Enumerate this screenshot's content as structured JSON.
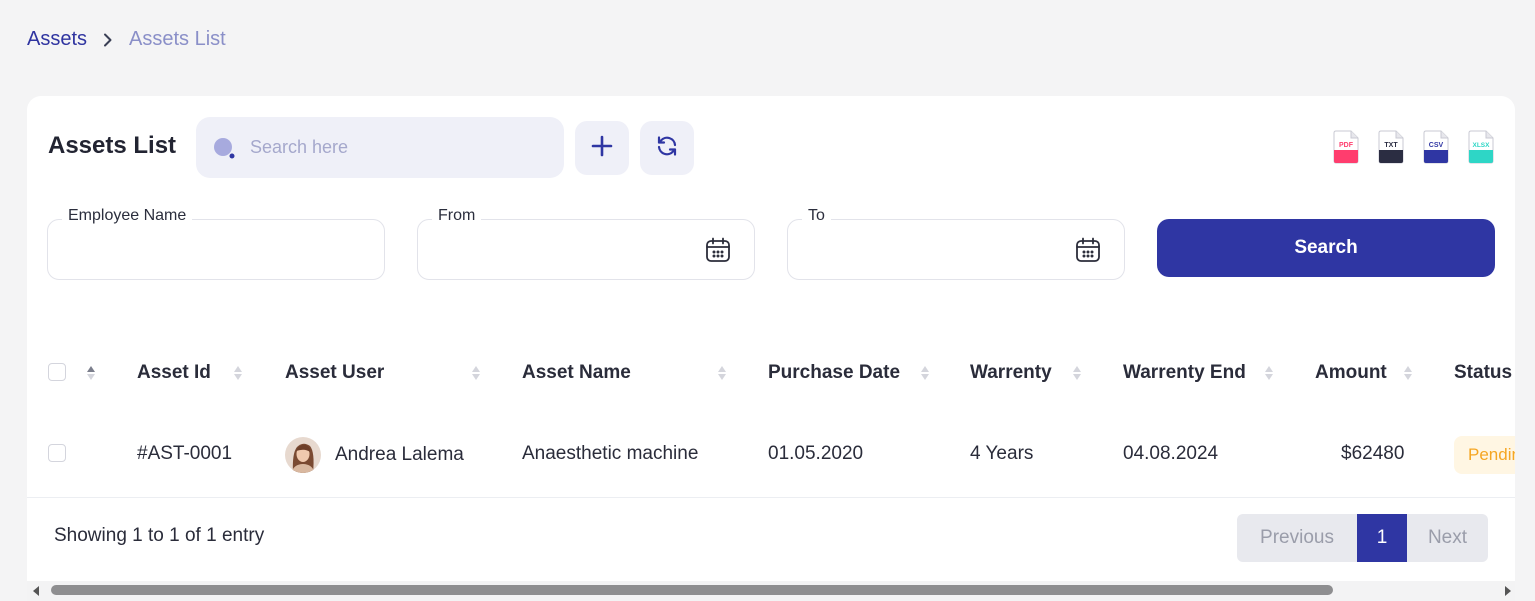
{
  "breadcrumb": {
    "root": "Assets",
    "current": "Assets List"
  },
  "card": {
    "title": "Assets List",
    "search_placeholder": "Search here",
    "export_icons": [
      "pdf-file-icon",
      "txt-file-icon",
      "csv-file-icon",
      "xlsx-file-icon"
    ],
    "export_labels": {
      "pdf": "PDF",
      "txt": "TXT",
      "csv": "CSV",
      "xlsx": "XLSX"
    }
  },
  "filters": {
    "employee_name_label": "Employee Name",
    "from_label": "From",
    "to_label": "To",
    "search_button": "Search"
  },
  "table": {
    "headers": [
      "Asset Id",
      "Asset User",
      "Asset Name",
      "Purchase Date",
      "Warrenty",
      "Warrenty End",
      "Amount",
      "Status"
    ],
    "rows": [
      {
        "asset_id": "#AST-0001",
        "asset_user": "Andrea Lalema",
        "asset_name": "Anaesthetic machine",
        "purchase_date": "01.05.2020",
        "warrenty": "4 Years",
        "warrenty_end": "04.08.2024",
        "amount": "$62480",
        "status": "Pending"
      }
    ]
  },
  "footer": {
    "showing_text": "Showing 1 to 1 of 1 entry",
    "previous": "Previous",
    "page": "1",
    "next": "Next"
  },
  "colors": {
    "primary": "#2f36a3",
    "pdf": "#ff3d6e",
    "txt": "#2b2d42",
    "csv": "#2f36a3",
    "xlsx": "#2ed6c6",
    "pending_bg": "#fff6e3",
    "pending_text": "#f5a623"
  }
}
